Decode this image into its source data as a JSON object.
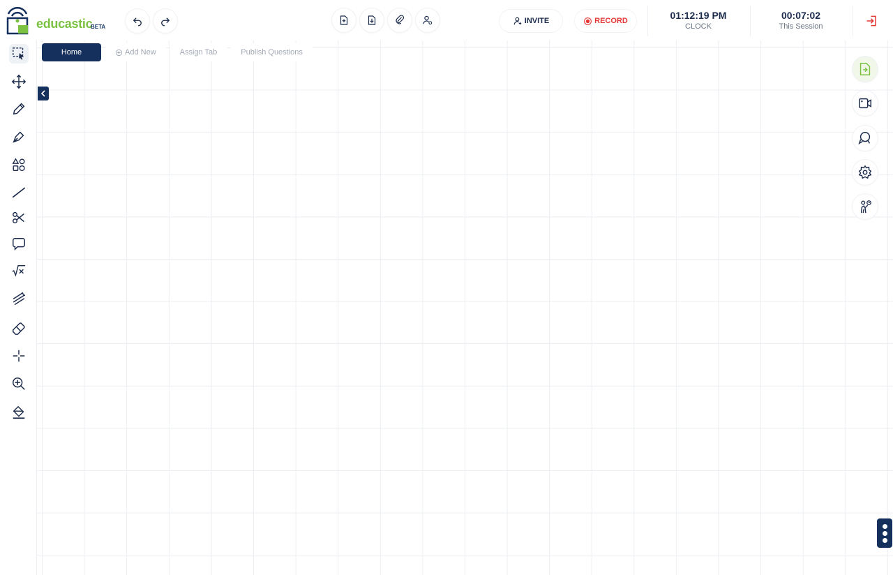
{
  "brand": {
    "name": "educastic",
    "badge": "BETA",
    "color": "#7cc242",
    "navy": "#16305e"
  },
  "toolbar": {
    "undo_icon": "undo-icon",
    "redo_icon": "redo-icon",
    "file_icons": [
      "add-file-icon",
      "download-file-icon",
      "attachment-icon",
      "user-settings-icon"
    ],
    "invite_label": "INVITE",
    "record_label": "RECORD",
    "record_color": "#e53935",
    "exit_icon": "sign-in-icon"
  },
  "clock": {
    "time": "01:12:19 PM",
    "label": "CLOCK"
  },
  "session": {
    "time": "00:07:02",
    "label": "This Session"
  },
  "tabs": [
    {
      "label": "Home",
      "active": true
    },
    {
      "label": "Add New",
      "active": false
    },
    {
      "label": "Assign Tab",
      "active": false
    },
    {
      "label": "Publish Questions",
      "active": false
    }
  ],
  "tools": [
    "select-icon",
    "move-icon",
    "pencil-icon",
    "pen-icon",
    "shapes-icon",
    "line-icon",
    "scissors-icon",
    "comment-icon",
    "math-icon",
    "highlighter-icon",
    "eraser-icon",
    "crosshair-icon",
    "zoom-in-icon",
    "fill-icon"
  ],
  "right_tools": [
    "share-screen-icon",
    "video-icon",
    "chat-icon",
    "settings-icon",
    "hand-raise-icon"
  ]
}
